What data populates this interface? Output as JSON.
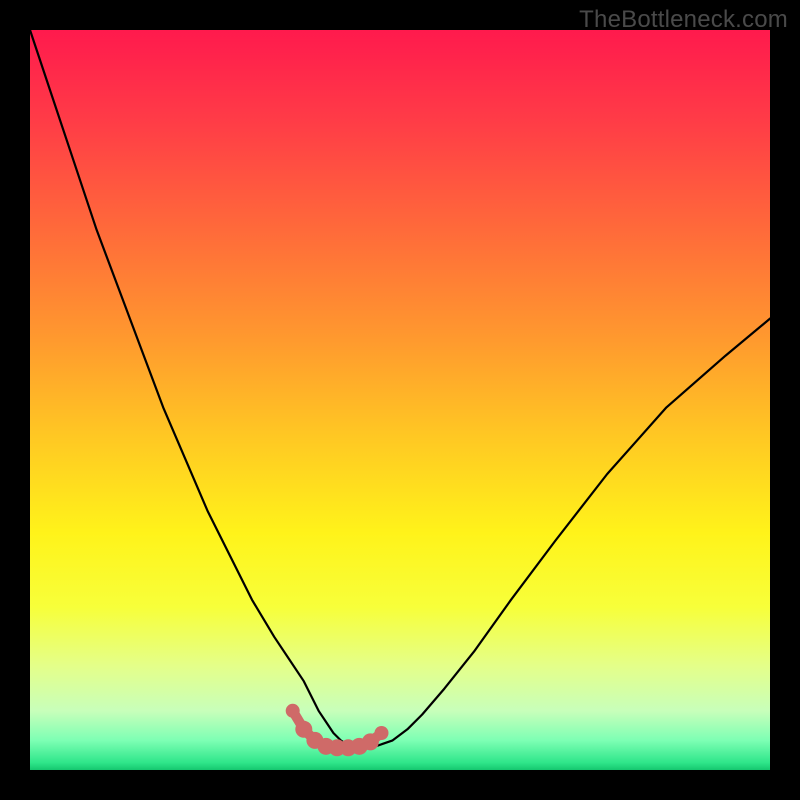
{
  "watermark": "TheBottleneck.com",
  "colors": {
    "frame": "#000000",
    "curve_stroke": "#000000",
    "marker_fill": "#cf6a68",
    "marker_stroke": "#cf6a68"
  },
  "chart_data": {
    "type": "line",
    "title": "",
    "xlabel": "",
    "ylabel": "",
    "xlim": [
      0,
      100
    ],
    "ylim": [
      0,
      100
    ],
    "grid": false,
    "legend": false,
    "x": [
      0,
      3,
      6,
      9,
      12,
      15,
      18,
      21,
      24,
      27,
      30,
      33,
      35,
      37,
      38,
      39,
      40,
      41,
      42,
      43,
      44,
      45,
      47,
      49,
      51,
      53,
      56,
      60,
      65,
      71,
      78,
      86,
      94,
      100
    ],
    "values": [
      100,
      91,
      82,
      73,
      65,
      57,
      49,
      42,
      35,
      29,
      23,
      18,
      15,
      12,
      10,
      8,
      6.5,
      5,
      4,
      3.3,
      3,
      3,
      3.3,
      4,
      5.5,
      7.5,
      11,
      16,
      23,
      31,
      40,
      49,
      56,
      61
    ],
    "markers": {
      "x": [
        35.5,
        37.0,
        38.5,
        40.0,
        41.5,
        43.0,
        44.5,
        46.0,
        47.5
      ],
      "y": [
        8.0,
        5.5,
        4.0,
        3.2,
        3.0,
        3.0,
        3.2,
        3.8,
        5.0
      ]
    }
  }
}
